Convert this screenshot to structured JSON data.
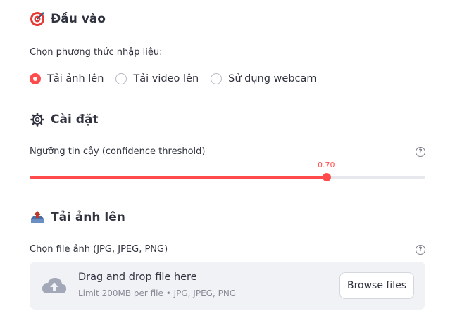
{
  "input_section": {
    "icon": "target-icon",
    "title": "Đầu vào",
    "method_label": "Chọn phương thức nhập liệu:",
    "options": [
      {
        "label": "Tải ảnh lên",
        "selected": true
      },
      {
        "label": "Tải video lên",
        "selected": false
      },
      {
        "label": "Sử dụng webcam",
        "selected": false
      }
    ]
  },
  "settings_section": {
    "icon": "gear-icon",
    "title": "Cài đặt",
    "confidence": {
      "label": "Ngưỡng tin cậy (confidence threshold)",
      "value": "0.70",
      "fraction": 0.75
    }
  },
  "upload_section": {
    "icon": "upload-tray-icon",
    "title": "Tải ảnh lên",
    "file_label": "Chọn file ảnh (JPG, JPEG, PNG)",
    "dropzone_title": "Drag and drop file here",
    "dropzone_sub": "Limit 200MB per file • JPG, JPEG, PNG",
    "browse_label": "Browse files"
  },
  "colors": {
    "accent": "#ff4b4b",
    "text": "#31333f",
    "muted": "#888a95",
    "dropzone_bg": "#f0f2f6"
  }
}
